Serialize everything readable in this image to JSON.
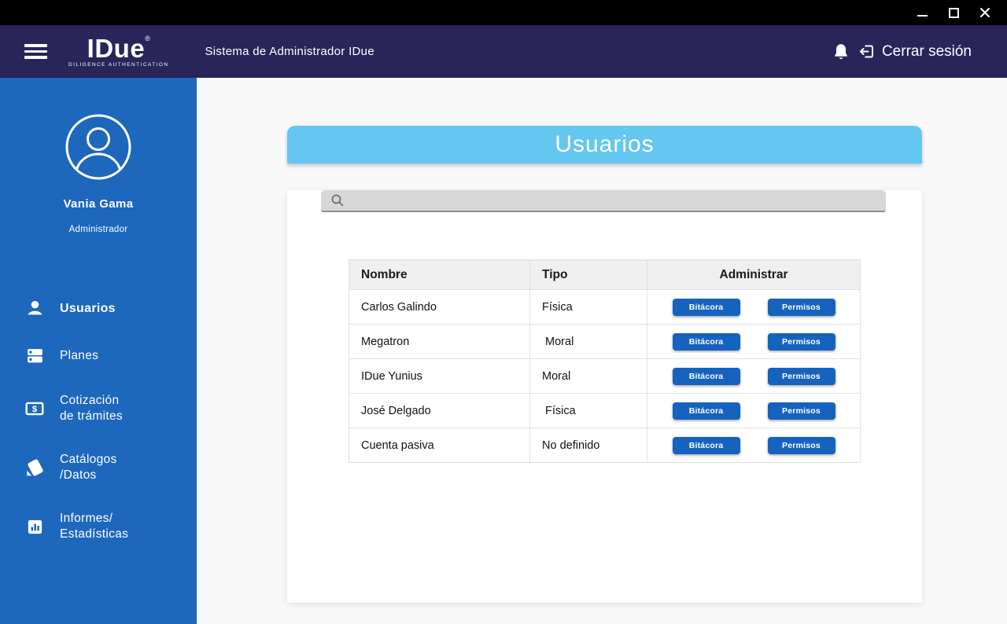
{
  "window_controls": {
    "minimize": "minimize",
    "maximize": "maximize",
    "close": "close"
  },
  "header": {
    "menu_icon": "hamburger-icon",
    "logo": {
      "text": "IDue",
      "mark": "®",
      "tagline": "DILIGENCE AUTHENTICATION"
    },
    "app_title": "Sistema de Administrador IDue",
    "notifications_icon": "bell-icon",
    "logout": {
      "icon": "logout-icon",
      "label": "Cerrar sesión"
    }
  },
  "sidebar": {
    "user": {
      "avatar_icon": "person-circle-icon",
      "name": "Vania Gama",
      "role": "Administrador"
    },
    "items": [
      {
        "label": "Usuarios",
        "icon": "person-icon",
        "active": true
      },
      {
        "label": "Planes",
        "icon": "plans-icon",
        "active": false
      },
      {
        "label": "Cotización\nde trámites",
        "icon": "money-icon",
        "active": false
      },
      {
        "label": "Catálogos\n/Datos",
        "icon": "catalog-icon",
        "active": false
      },
      {
        "label": "Informes/\nEstadísticas",
        "icon": "bar-chart-icon",
        "active": false
      }
    ]
  },
  "main": {
    "title": "Usuarios",
    "search": {
      "value": "",
      "icon": "search-icon"
    },
    "table": {
      "columns": [
        "Nombre",
        "Tipo",
        "Administrar"
      ],
      "action_labels": [
        "Bitácora",
        "Permisos"
      ],
      "rows": [
        {
          "nombre": "Carlos Galindo",
          "tipo": "Física"
        },
        {
          "nombre": "Megatron",
          "tipo": " Moral"
        },
        {
          "nombre": "IDue Yunius",
          "tipo": "Moral"
        },
        {
          "nombre": "José Delgado",
          "tipo": " Física"
        },
        {
          "nombre": "Cuenta pasiva",
          "tipo": "No definido"
        }
      ]
    }
  },
  "colors": {
    "titlebar": "#000000",
    "header": "#292559",
    "sidebar": "#1D67BD",
    "banner": "#64C7EF",
    "button": "#1563BE",
    "page_bg": "#F9F9FA"
  }
}
